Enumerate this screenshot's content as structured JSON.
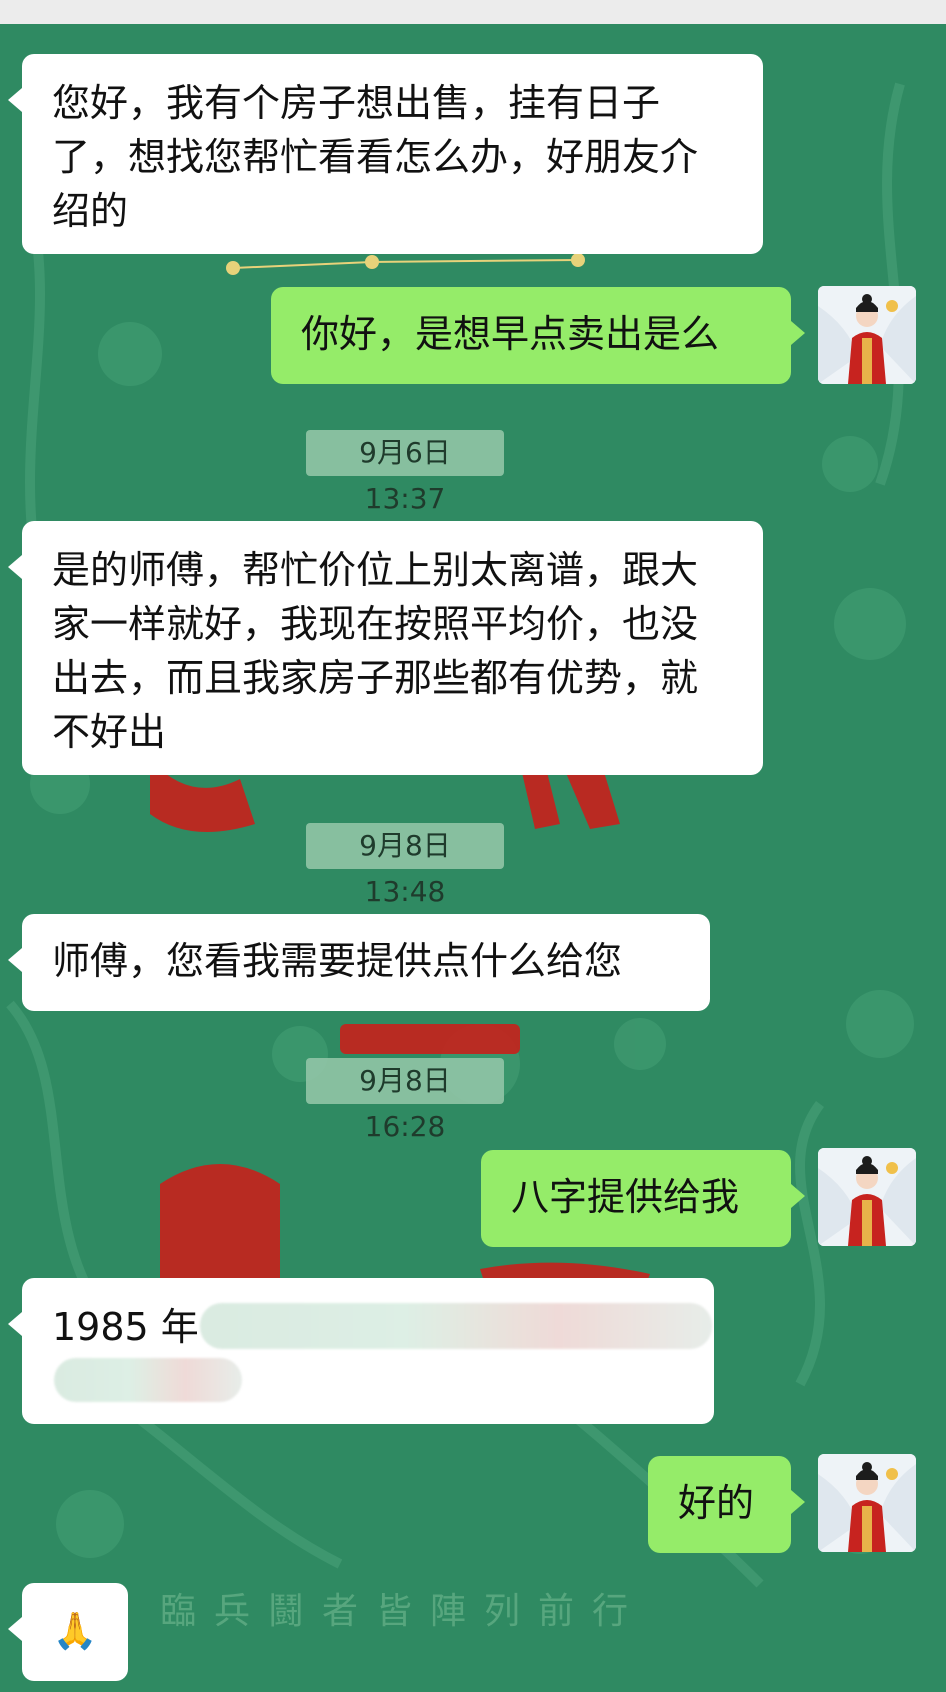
{
  "messages": [
    {
      "side": "left",
      "text": "您好，我有个房子想出售，挂有日子了，想找您帮忙看看怎么办，好朋友介绍的"
    },
    {
      "side": "right",
      "text": "你好，是想早点卖出是么"
    },
    {
      "timestamp": "9月6日 13:37"
    },
    {
      "side": "left",
      "text": "是的师傅，帮忙价位上别太离谱，跟大家一样就好，我现在按照平均价，也没出去，而且我家房子那些都有优势，就不好出"
    },
    {
      "timestamp": "9月8日 13:48"
    },
    {
      "side": "left",
      "text": "师傅，您看我需要提供点什么给您"
    },
    {
      "timestamp": "9月8日 16:28"
    },
    {
      "side": "right",
      "text": "八字提供给我"
    },
    {
      "side": "left",
      "text": "1985 年"
    },
    {
      "side": "right",
      "text": "好的"
    },
    {
      "side": "left",
      "emoji": "🙏"
    }
  ],
  "background": {
    "motto": "臨兵鬪者皆陣列前行",
    "color": "#2f8a62"
  },
  "colors": {
    "incoming_bubble": "#ffffff",
    "outgoing_bubble": "#95ec69",
    "timestamp_bg": "#96c8aa"
  },
  "avatar": {
    "icon": "avatar-woman-red-robe-icon"
  }
}
